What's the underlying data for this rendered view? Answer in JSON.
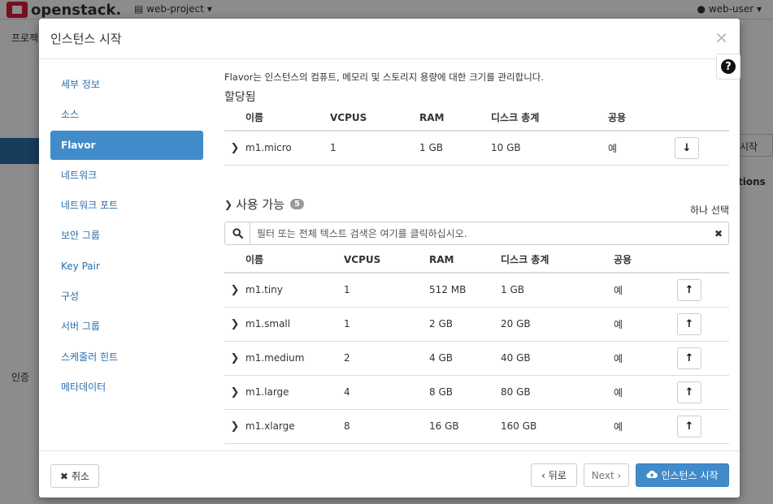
{
  "background": {
    "brand": "openstack.",
    "project": "web-project",
    "user": "web-user",
    "breadcrumb": "프로젝",
    "right_button": "시작",
    "right_column": "tions",
    "auth_label": "인증"
  },
  "modal": {
    "title": "인스턴스 시작",
    "close_symbol": "✕",
    "help_symbol": "?"
  },
  "wizard_nav": {
    "items": [
      {
        "label": "세부 정보"
      },
      {
        "label": "소스"
      },
      {
        "label": "Flavor"
      },
      {
        "label": "네트워크"
      },
      {
        "label": "네트워크 포트"
      },
      {
        "label": "보안 그룹"
      },
      {
        "label": "Key Pair"
      },
      {
        "label": "구성"
      },
      {
        "label": "서버 그룹"
      },
      {
        "label": "스케줄러 힌트"
      },
      {
        "label": "메타데이터"
      }
    ],
    "active_index": 2
  },
  "flavor": {
    "description": "Flavor는 인스턴스의 컴퓨트, 메모리 및 스토리지 용량에 대한 크기를 관리합니다.",
    "allocated_title": "할당됨",
    "columns": [
      "이름",
      "VCPUS",
      "RAM",
      "디스크 총계",
      "공용"
    ],
    "allocated": [
      {
        "name": "m1.micro",
        "vcpus": "1",
        "ram": "1 GB",
        "disk": "10 GB",
        "public": "예"
      }
    ],
    "available_title": "사용 가능",
    "available_count": "5",
    "select_one": "하나 선택",
    "search_placeholder": "필터 또는 전체 텍스트 검색은 여기를 클릭하십시오.",
    "available": [
      {
        "name": "m1.tiny",
        "vcpus": "1",
        "ram": "512 MB",
        "disk": "1 GB",
        "public": "예"
      },
      {
        "name": "m1.small",
        "vcpus": "1",
        "ram": "2 GB",
        "disk": "20 GB",
        "public": "예"
      },
      {
        "name": "m1.medium",
        "vcpus": "2",
        "ram": "4 GB",
        "disk": "40 GB",
        "public": "예"
      },
      {
        "name": "m1.large",
        "vcpus": "4",
        "ram": "8 GB",
        "disk": "80 GB",
        "public": "예"
      },
      {
        "name": "m1.xlarge",
        "vcpus": "8",
        "ram": "16 GB",
        "disk": "160 GB",
        "public": "예"
      }
    ]
  },
  "footer": {
    "cancel": "취소",
    "back": "‹ 뒤로",
    "next": "Next ›",
    "launch": "인스턴스 시작"
  }
}
